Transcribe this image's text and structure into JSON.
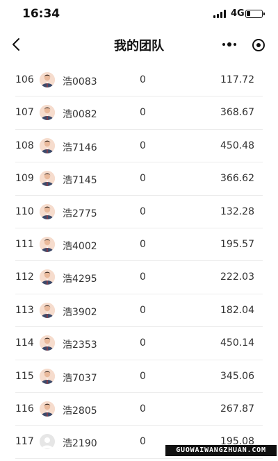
{
  "status_bar": {
    "time": "16:34",
    "network": "4G"
  },
  "nav": {
    "title": "我的团队",
    "back_icon": "chevron-left-icon",
    "more_icon": "more-dots-icon",
    "close_icon": "target-close-icon"
  },
  "rows": [
    {
      "rank": "106",
      "name": "浩0083",
      "count": "0",
      "amount": "117.72",
      "avatar": "photo"
    },
    {
      "rank": "107",
      "name": "浩0082",
      "count": "0",
      "amount": "368.67",
      "avatar": "photo"
    },
    {
      "rank": "108",
      "name": "浩7146",
      "count": "0",
      "amount": "450.48",
      "avatar": "photo"
    },
    {
      "rank": "109",
      "name": "浩7145",
      "count": "0",
      "amount": "366.62",
      "avatar": "photo"
    },
    {
      "rank": "110",
      "name": "浩2775",
      "count": "0",
      "amount": "132.28",
      "avatar": "photo"
    },
    {
      "rank": "111",
      "name": "浩4002",
      "count": "0",
      "amount": "195.57",
      "avatar": "photo"
    },
    {
      "rank": "112",
      "name": "浩4295",
      "count": "0",
      "amount": "222.03",
      "avatar": "photo"
    },
    {
      "rank": "113",
      "name": "浩3902",
      "count": "0",
      "amount": "182.04",
      "avatar": "photo"
    },
    {
      "rank": "114",
      "name": "浩2353",
      "count": "0",
      "amount": "450.14",
      "avatar": "photo"
    },
    {
      "rank": "115",
      "name": "浩7037",
      "count": "0",
      "amount": "345.06",
      "avatar": "photo"
    },
    {
      "rank": "116",
      "name": "浩2805",
      "count": "0",
      "amount": "267.87",
      "avatar": "photo"
    },
    {
      "rank": "117",
      "name": "浩2190",
      "count": "0",
      "amount": "195.08",
      "avatar": "placeholder"
    }
  ],
  "watermark": "GUOWAIWANGZHUAN.COM"
}
